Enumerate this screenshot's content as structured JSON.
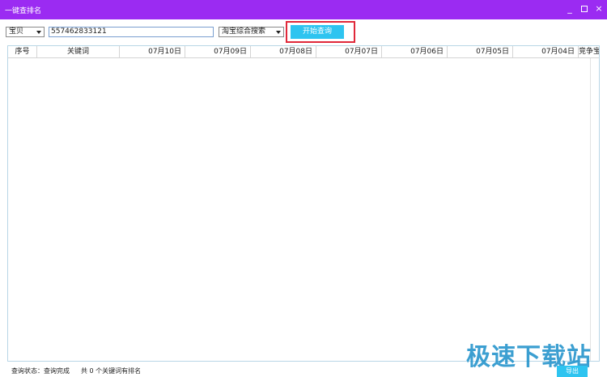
{
  "window": {
    "title": "一键查排名",
    "minimize": "_",
    "close": "×"
  },
  "toolbar": {
    "type_select": "宝贝",
    "item_id": "557462833121",
    "search_type_select": "淘宝综合搜索",
    "start_button": "开始查询"
  },
  "table": {
    "columns": [
      "序号",
      "关键词",
      "07月10日",
      "07月09日",
      "07月08日",
      "07月07日",
      "07月06日",
      "07月05日",
      "07月04日",
      "竞争宝贝"
    ]
  },
  "status": {
    "state_label": "查询状态：查询完成",
    "summary": "共 0 个关键词有排名"
  },
  "export_button": "导出",
  "watermark": "极速下载站"
}
